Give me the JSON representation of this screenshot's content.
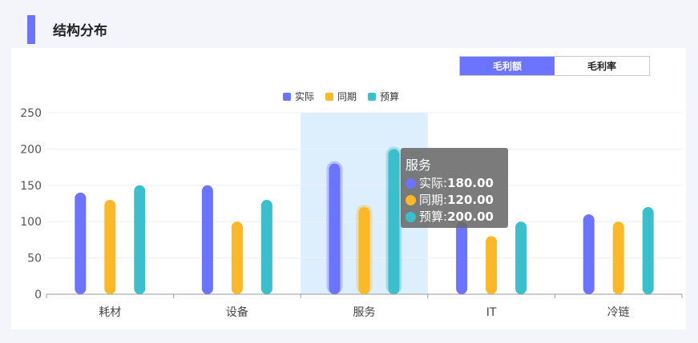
{
  "header": {
    "title": "结构分布"
  },
  "toggle": {
    "options": [
      "毛利额",
      "毛利率"
    ],
    "active_index": 0
  },
  "tooltip": {
    "title": "服务",
    "rows": [
      {
        "name": "实际",
        "value": "180.00"
      },
      {
        "name": "同期",
        "value": "120.00"
      },
      {
        "name": "预算",
        "value": "200.00"
      }
    ]
  },
  "colors": {
    "actual": "#6b73ff",
    "prior": "#fbb829",
    "budget": "#3cbfcc",
    "highlight": "#ddeefc",
    "accent": "#6b73ff"
  },
  "chart_data": {
    "type": "bar",
    "categories": [
      "耗材",
      "设备",
      "服务",
      "IT",
      "冷链"
    ],
    "series": [
      {
        "name": "实际",
        "values": [
          140,
          150,
          180,
          100,
          110
        ]
      },
      {
        "name": "同期",
        "values": [
          130,
          100,
          120,
          80,
          100
        ]
      },
      {
        "name": "预算",
        "values": [
          150,
          130,
          200,
          100,
          120
        ]
      }
    ],
    "yticks": [
      0,
      50,
      100,
      150,
      200,
      250
    ],
    "ylim": [
      0,
      250
    ],
    "highlighted_category": "服务",
    "legend_position": "top-center",
    "grid": true
  }
}
